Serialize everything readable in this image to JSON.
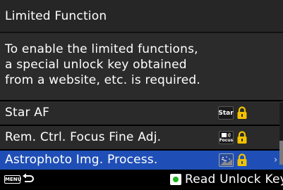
{
  "title": "Limited Function",
  "message": {
    "lines": [
      "To enable the limited functions,",
      "a special unlock key obtained",
      "from a website, etc. is required."
    ]
  },
  "items": [
    {
      "label": "Star AF",
      "icon": "star-af-icon",
      "icon_text": "Star",
      "locked": true,
      "selected": false
    },
    {
      "label": "Rem. Ctrl. Focus Fine Adj.",
      "icon": "remote-focus-icon",
      "icon_text": "Focus",
      "locked": true,
      "selected": false
    },
    {
      "label": "Astrophoto Img. Process.",
      "icon": "astrophoto-icon",
      "locked": true,
      "selected": true
    }
  ],
  "footer": {
    "menu_key_label": "MENU",
    "back_icon": "back-arrow-icon",
    "green_button_icon": "green-button-icon",
    "unlock_label": "Read Unlock Key"
  },
  "colors": {
    "selected_row": "#1f4fb6",
    "row_bg": "#2a2a2a",
    "lock": "#f2c200",
    "green_button": "#1db31d"
  }
}
